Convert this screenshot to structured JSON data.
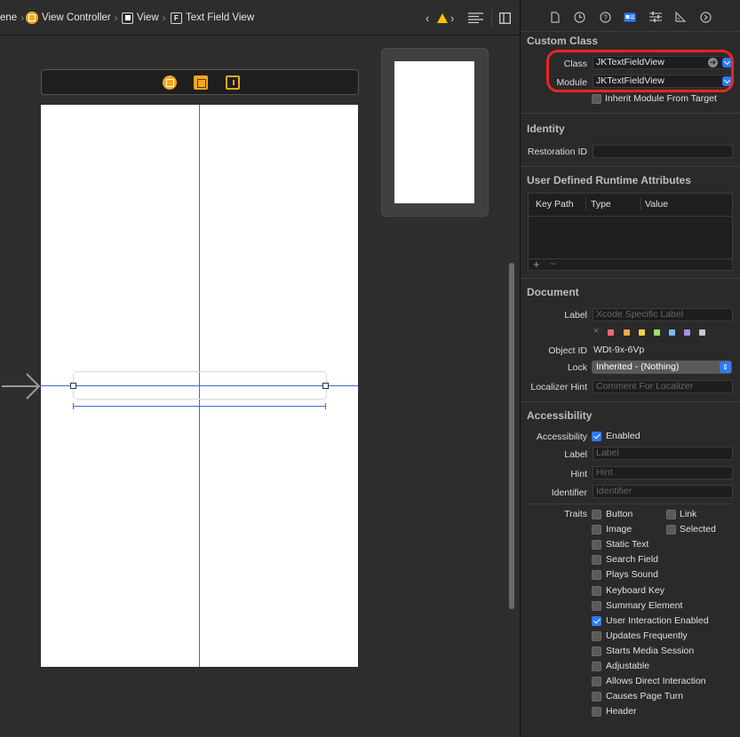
{
  "breadcrumb": {
    "scene_fragment": "ene",
    "items": [
      "View Controller",
      "View",
      "Text Field View"
    ]
  },
  "toolbar_icons": [
    "warning-icon",
    "chevron-left-icon",
    "chevron-right-icon",
    "adjust-editor-icon",
    "add-editor-icon"
  ],
  "inspector_tabs": [
    "file-icon",
    "history-icon",
    "help-icon",
    "identity-icon",
    "attributes-icon",
    "size-icon",
    "connections-icon"
  ],
  "custom_class": {
    "title": "Custom Class",
    "class_label": "Class",
    "class_value": "JKTextFieldView",
    "module_label": "Module",
    "module_value": "JKTextFieldView",
    "inherit_label": "Inherit Module From Target",
    "inherit_checked": false
  },
  "identity": {
    "title": "Identity",
    "restoration_label": "Restoration ID",
    "restoration_value": ""
  },
  "runtime_attrs": {
    "title": "User Defined Runtime Attributes",
    "columns": [
      "Key Path",
      "Type",
      "Value"
    ],
    "add": "+",
    "remove": "−"
  },
  "document": {
    "title": "Document",
    "label_label": "Label",
    "label_placeholder": "Xcode Specific Label",
    "swatch_clear": "×",
    "swatches": [
      "#f26b6b",
      "#f2a84e",
      "#f2d14e",
      "#a3e06a",
      "#7ab8f2",
      "#b08af2",
      "#c8c8c8"
    ],
    "object_id_label": "Object ID",
    "object_id": "WDt-9x-6Vp",
    "lock_label": "Lock",
    "lock_value": "Inherited - (Nothing)",
    "hint_label": "Localizer Hint",
    "hint_placeholder": "Comment For Localizer"
  },
  "accessibility": {
    "title": "Accessibility",
    "accessibility_label": "Accessibility",
    "enabled_label": "Enabled",
    "enabled_checked": true,
    "label_label": "Label",
    "label_placeholder": "Label",
    "hint_label": "Hint",
    "hint_placeholder": "Hint",
    "identifier_label": "Identifier",
    "identifier_placeholder": "Identifier",
    "traits_label": "Traits",
    "traits_right": [
      {
        "label": "Link",
        "checked": false
      },
      {
        "label": "Selected",
        "checked": false
      }
    ],
    "traits": [
      {
        "label": "Button",
        "checked": false
      },
      {
        "label": "Image",
        "checked": false
      },
      {
        "label": "Static Text",
        "checked": false
      },
      {
        "label": "Search Field",
        "checked": false
      },
      {
        "label": "Plays Sound",
        "checked": false
      },
      {
        "label": "Keyboard Key",
        "checked": false
      },
      {
        "label": "Summary Element",
        "checked": false
      },
      {
        "label": "User Interaction Enabled",
        "checked": true
      },
      {
        "label": "Updates Frequently",
        "checked": false
      },
      {
        "label": "Starts Media Session",
        "checked": false
      },
      {
        "label": "Adjustable",
        "checked": false
      },
      {
        "label": "Allows Direct Interaction",
        "checked": false
      },
      {
        "label": "Causes Page Turn",
        "checked": false
      },
      {
        "label": "Header",
        "checked": false
      }
    ]
  },
  "colors": {
    "accent": "#2f7bf5",
    "view_controller": "#f2a81d",
    "guide": "#3a6ed1",
    "highlight": "#ee2222",
    "warning": "#f5c400"
  }
}
